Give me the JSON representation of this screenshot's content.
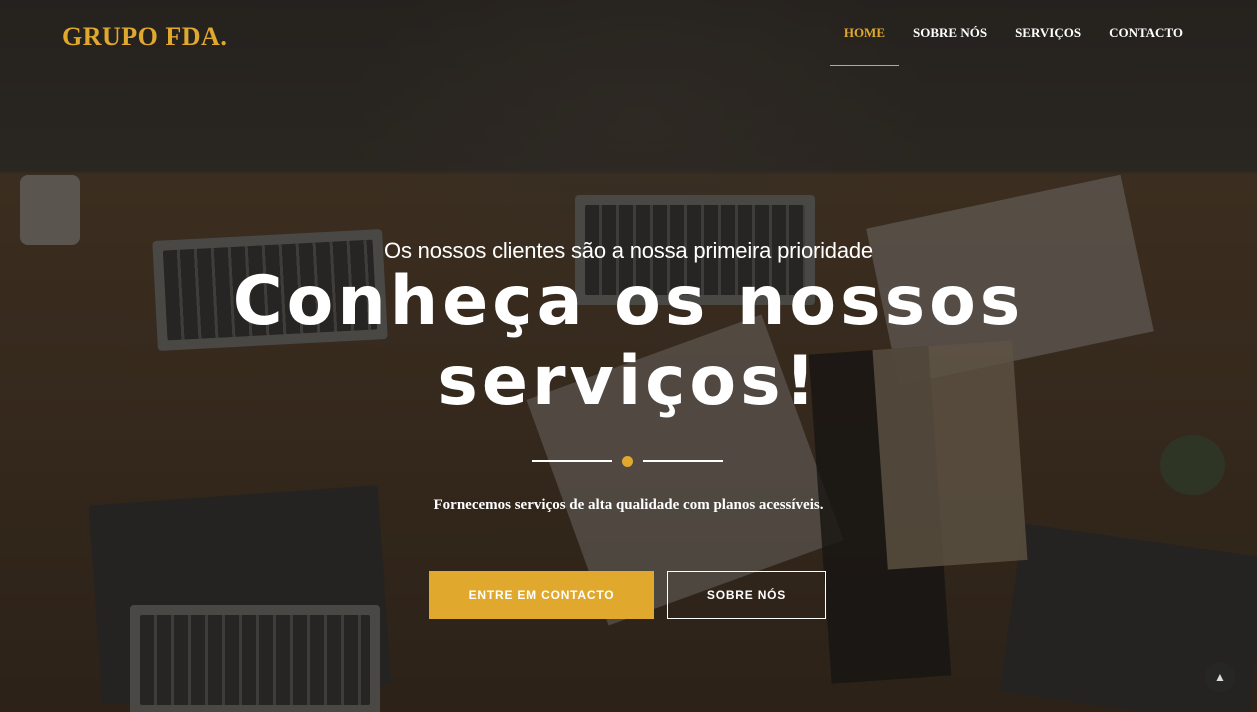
{
  "brand": {
    "name": "GRUPO FDA."
  },
  "nav": {
    "items": [
      {
        "label": "HOME",
        "active": true
      },
      {
        "label": "SOBRE NÓS",
        "active": false
      },
      {
        "label": "SERVIÇOS",
        "active": false
      },
      {
        "label": "CONTACTO",
        "active": false
      }
    ]
  },
  "hero": {
    "subtitle": "Os nossos clientes são a nossa primeira prioridade",
    "title_line1": "Conheça os nossos",
    "title_line2": "serviços!",
    "tagline": "Fornecemos serviços de alta qualidade com planos acessíveis.",
    "primary_button": "ENTRE EM CONTACTO",
    "secondary_button": "SOBRE NÓS"
  },
  "scroll_top": {
    "icon": "chevron-up-icon",
    "glyph": "▲"
  },
  "colors": {
    "accent": "#e0a92e",
    "text": "#ffffff"
  }
}
